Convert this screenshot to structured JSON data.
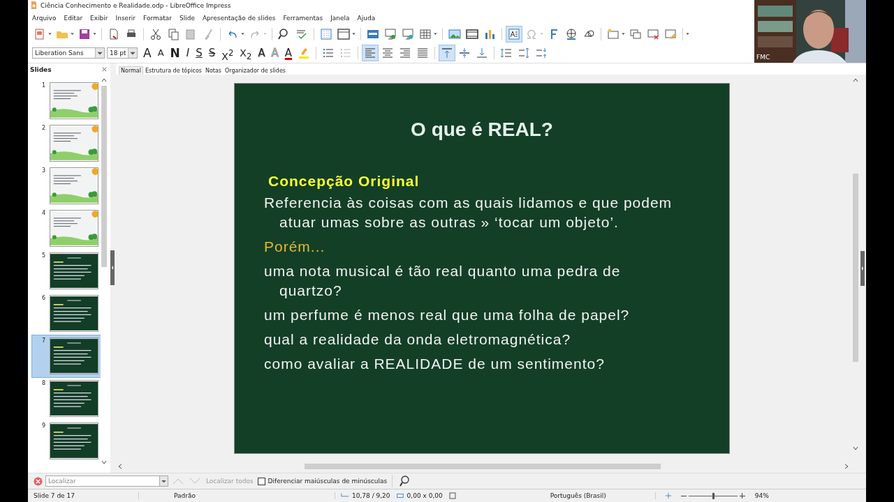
{
  "window": {
    "title": "Ciência Conhecimento e Realidade.odp - LibreOffice Impress"
  },
  "menu": [
    "Arquivo",
    "Editar",
    "Exibir",
    "Inserir",
    "Formatar",
    "Slide",
    "Apresentação de slides",
    "Ferramentas",
    "Janela",
    "Ajuda"
  ],
  "main_toolbar": {
    "text_box_selected": true
  },
  "text_toolbar": {
    "font": "Liberation Sans",
    "size": "18 pt",
    "alignments": [
      {
        "kind": "left",
        "selected": true
      },
      {
        "kind": "center",
        "selected": false
      },
      {
        "kind": "right",
        "selected": false
      },
      {
        "kind": "justify",
        "selected": false
      }
    ],
    "vertical_alignments": [
      {
        "kind": "top",
        "selected": true
      },
      {
        "kind": "center",
        "selected": false
      },
      {
        "kind": "bottom",
        "selected": false
      }
    ],
    "style_buttons": [
      {
        "label": "A",
        "kind": "grow"
      },
      {
        "label": "A",
        "kind": "shrink"
      },
      {
        "label": "N",
        "kind": "bold"
      },
      {
        "label": "I",
        "kind": "italic"
      },
      {
        "label": "S",
        "kind": "underline"
      },
      {
        "label": "S",
        "kind": "strike"
      },
      {
        "label": "X$^{2}$",
        "kind": "plain"
      },
      {
        "label": "X$_{2}$",
        "kind": "plain"
      },
      {
        "label": "A",
        "kind": "shadow"
      },
      {
        "label": "A",
        "kind": "outline"
      },
      {
        "label": "A",
        "kind": "color"
      }
    ]
  },
  "video": {
    "label": "FMC"
  },
  "slides_panel": {
    "title": "Slides",
    "slides": [
      {
        "number": "1",
        "kind": "light",
        "selected": false
      },
      {
        "number": "2",
        "kind": "light",
        "selected": false
      },
      {
        "number": "3",
        "kind": "light",
        "selected": false
      },
      {
        "number": "4",
        "kind": "light",
        "selected": false
      },
      {
        "number": "5",
        "kind": "dark",
        "selected": false
      },
      {
        "number": "6",
        "kind": "dark",
        "selected": false
      },
      {
        "number": "7",
        "kind": "dark",
        "selected": true
      },
      {
        "number": "8",
        "kind": "dark",
        "selected": false
      },
      {
        "number": "9",
        "kind": "dark",
        "selected": false
      }
    ]
  },
  "view_tabs": [
    {
      "label": "Normal",
      "selected": true
    },
    {
      "label": "Estrutura de tópicos",
      "selected": false
    },
    {
      "label": "Notas",
      "selected": false
    },
    {
      "label": "Organizador de slides",
      "selected": false
    }
  ],
  "slide": {
    "title": "O que é REAL?",
    "items": [
      {
        "kind": "heading",
        "text": "Concepção Original"
      },
      {
        "kind": "body",
        "text": "Referencia às coisas com as quais lidamos e que podem atuar umas sobre as outras » ‘tocar um objeto’."
      },
      {
        "kind": "accent",
        "text": "Porém..."
      },
      {
        "kind": "body",
        "text": "uma nota musical é tão real quanto uma pedra de quartzo?"
      },
      {
        "kind": "body",
        "text": "um perfume é menos real que uma folha de papel?"
      },
      {
        "kind": "body",
        "text": "qual a realidade da onda eletromagnética?"
      },
      {
        "kind": "body",
        "text": "como avaliar a REALIDADE de um sentimento?"
      }
    ]
  },
  "find_bar": {
    "placeholder": "Localizar",
    "find_all": "Localizar todos",
    "match_case": {
      "label": "Diferenciar maiúsculas de minúsculas",
      "checked": false
    }
  },
  "status_bar": {
    "slide": "Slide 7 de 17",
    "layout": "Padrão",
    "position": "10,78 / 9,20",
    "size": "0,00 x 0,00",
    "language": "Português (Brasil)",
    "zoom": {
      "level": 0.5,
      "reading": "94%"
    }
  }
}
